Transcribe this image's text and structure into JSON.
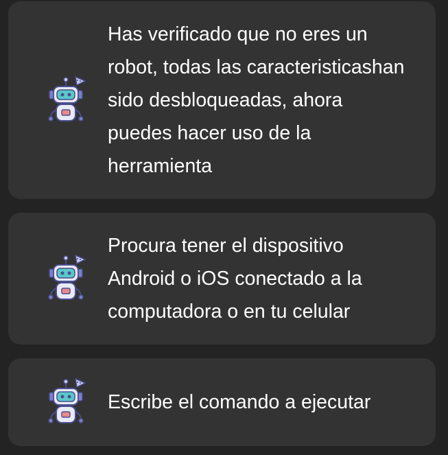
{
  "messages": [
    {
      "icon": "robot-icon",
      "text": "Has verificado que no eres un robot, todas las caracteristicashan sido desbloqueadas, ahora puedes hacer uso de la herramienta"
    },
    {
      "icon": "robot-icon",
      "text": "Procura tener el dispositivo Android o iOS conectado a la computadora o en tu celular"
    },
    {
      "icon": "robot-icon",
      "text": "Escribe el comando a ejecutar"
    }
  ],
  "colors": {
    "background": "#232323",
    "card": "#333333",
    "text": "#ffffff",
    "robot_body": "#e9eaf7",
    "robot_outline": "#4a4e8f",
    "robot_visor": "#5ac8c8",
    "robot_accent": "#e98a8a"
  }
}
